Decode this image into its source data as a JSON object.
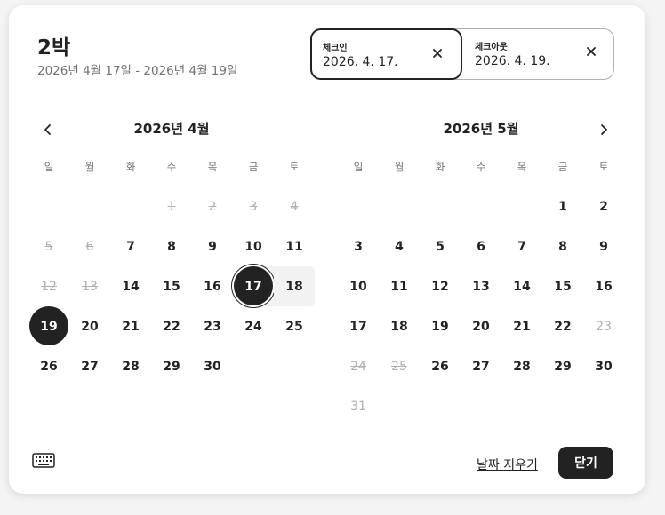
{
  "header": {
    "nights": "2박",
    "range": "2026년 4월 17일 - 2026년 4월 19일"
  },
  "checkin": {
    "label": "체크인",
    "value": "2026. 4. 17."
  },
  "checkout": {
    "label": "체크아웃",
    "value": "2026. 4. 19."
  },
  "weekdays": [
    "일",
    "월",
    "화",
    "수",
    "목",
    "금",
    "토"
  ],
  "months": [
    {
      "title": "2026년 4월",
      "weeks": [
        [
          {
            "d": ""
          },
          {
            "d": ""
          },
          {
            "d": ""
          },
          {
            "d": "1",
            "s": "dis"
          },
          {
            "d": "2",
            "s": "dis"
          },
          {
            "d": "3",
            "s": "dis"
          },
          {
            "d": "4",
            "s": "dis"
          }
        ],
        [
          {
            "d": "5",
            "s": "dis"
          },
          {
            "d": "6",
            "s": "dis"
          },
          {
            "d": "7"
          },
          {
            "d": "8"
          },
          {
            "d": "9"
          },
          {
            "d": "10"
          },
          {
            "d": "11"
          }
        ],
        [
          {
            "d": "12",
            "s": "dis"
          },
          {
            "d": "13",
            "s": "dis"
          },
          {
            "d": "14"
          },
          {
            "d": "15"
          },
          {
            "d": "16"
          },
          {
            "d": "17",
            "s": "sel-start"
          },
          {
            "d": "18",
            "s": "band-end"
          }
        ],
        [
          {
            "d": "19",
            "s": "sel-end"
          },
          {
            "d": "20"
          },
          {
            "d": "21"
          },
          {
            "d": "22"
          },
          {
            "d": "23"
          },
          {
            "d": "24"
          },
          {
            "d": "25"
          }
        ],
        [
          {
            "d": "26"
          },
          {
            "d": "27"
          },
          {
            "d": "28"
          },
          {
            "d": "29"
          },
          {
            "d": "30"
          },
          {
            "d": ""
          },
          {
            "d": ""
          }
        ]
      ]
    },
    {
      "title": "2026년 5월",
      "weeks": [
        [
          {
            "d": ""
          },
          {
            "d": ""
          },
          {
            "d": ""
          },
          {
            "d": ""
          },
          {
            "d": ""
          },
          {
            "d": "1"
          },
          {
            "d": "2"
          }
        ],
        [
          {
            "d": "3"
          },
          {
            "d": "4"
          },
          {
            "d": "5"
          },
          {
            "d": "6"
          },
          {
            "d": "7"
          },
          {
            "d": "8"
          },
          {
            "d": "9"
          }
        ],
        [
          {
            "d": "10"
          },
          {
            "d": "11"
          },
          {
            "d": "12"
          },
          {
            "d": "13"
          },
          {
            "d": "14"
          },
          {
            "d": "15"
          },
          {
            "d": "16"
          }
        ],
        [
          {
            "d": "17"
          },
          {
            "d": "18"
          },
          {
            "d": "19"
          },
          {
            "d": "20"
          },
          {
            "d": "21"
          },
          {
            "d": "22"
          },
          {
            "d": "23",
            "s": "lite"
          }
        ],
        [
          {
            "d": "24",
            "s": "dis"
          },
          {
            "d": "25",
            "s": "dis"
          },
          {
            "d": "26"
          },
          {
            "d": "27"
          },
          {
            "d": "28"
          },
          {
            "d": "29"
          },
          {
            "d": "30"
          }
        ],
        [
          {
            "d": "31",
            "s": "lite"
          },
          {
            "d": ""
          },
          {
            "d": ""
          },
          {
            "d": ""
          },
          {
            "d": ""
          },
          {
            "d": ""
          },
          {
            "d": ""
          }
        ]
      ]
    }
  ],
  "footer": {
    "clear_label": "날짜 지우기",
    "close_label": "닫기"
  },
  "icons": {
    "prev": "chevron-left-icon",
    "next": "chevron-right-icon",
    "keyboard": "keyboard-icon",
    "clear": "close-icon"
  },
  "colors": {
    "selected": "#222222",
    "range_band": "#f2f2f2",
    "muted": "#b0b0b0"
  }
}
